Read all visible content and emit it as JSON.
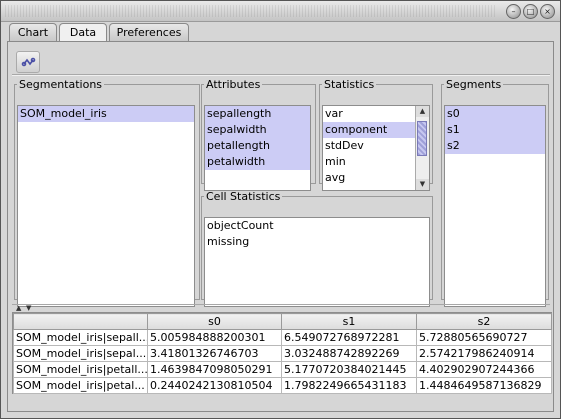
{
  "window": {
    "buttons": [
      "min",
      "max",
      "close"
    ]
  },
  "tabs": [
    {
      "label": "Chart",
      "active": false
    },
    {
      "label": "Data",
      "active": true
    },
    {
      "label": "Preferences",
      "active": false
    }
  ],
  "toolbar": {
    "refresh_icon": "refresh-icon"
  },
  "segmentations": {
    "title": "Segmentations",
    "items": [
      {
        "label": "SOM_model_iris",
        "selected": true
      }
    ]
  },
  "attributes": {
    "title": "Attributes",
    "items": [
      {
        "label": "sepallength",
        "selected": true
      },
      {
        "label": "sepalwidth",
        "selected": true
      },
      {
        "label": "petallength",
        "selected": true
      },
      {
        "label": "petalwidth",
        "selected": true
      }
    ]
  },
  "statistics": {
    "title": "Statistics",
    "items": [
      {
        "label": "var",
        "selected": false
      },
      {
        "label": "component",
        "selected": true
      },
      {
        "label": "stdDev",
        "selected": false
      },
      {
        "label": "min",
        "selected": false
      },
      {
        "label": "avg",
        "selected": false
      }
    ]
  },
  "segments": {
    "title": "Segments",
    "items": [
      {
        "label": "s0",
        "selected": true
      },
      {
        "label": "s1",
        "selected": true
      },
      {
        "label": "s2",
        "selected": true
      }
    ]
  },
  "cell_statistics": {
    "title": "Cell Statistics",
    "items": [
      {
        "label": "objectCount"
      },
      {
        "label": "missing"
      }
    ]
  },
  "table": {
    "headers": [
      "",
      "s0",
      "s1",
      "s2"
    ],
    "rows": [
      [
        "SOM_model_iris|sepall...",
        "5.005984888200301",
        "6.549072768972281",
        "5.72880565690727"
      ],
      [
        "SOM_model_iris|sepal...",
        "3.418013267467​03",
        "3.032488742892269",
        "2.574217986240914"
      ],
      [
        "SOM_model_iris|petall...",
        "1.4639847098050291",
        "5.1770720384021445",
        "4.402902907244366"
      ],
      [
        "SOM_model_iris|petal...",
        "0.2440242130810504",
        "1.7982249665431183",
        "1.4484649587136829"
      ]
    ]
  }
}
